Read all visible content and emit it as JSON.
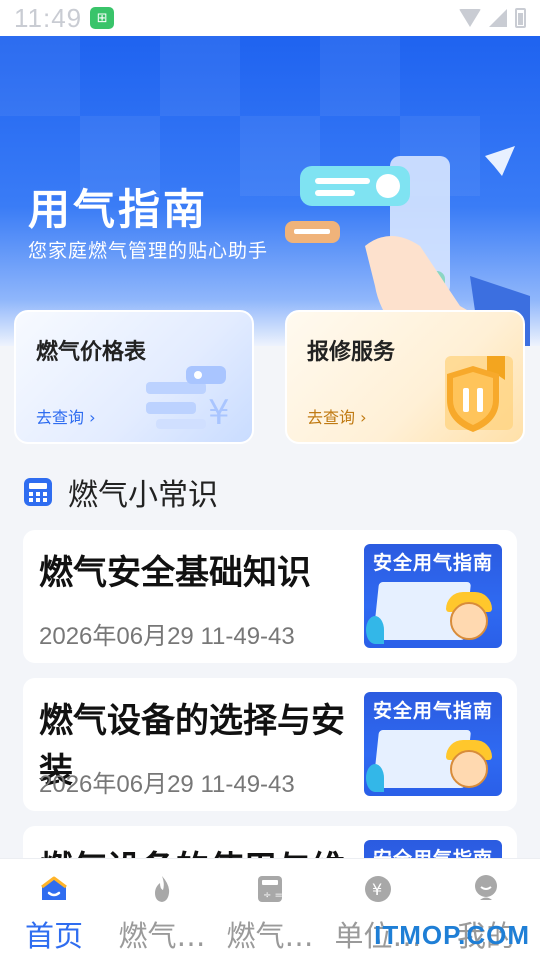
{
  "status_bar": {
    "time": "11:49",
    "notification_icon": "app-notification-icon"
  },
  "colors": {
    "primary": "#2f6df0",
    "hero_top": "#1f63f0",
    "repair_accent": "#c07a12",
    "tab_inactive": "#9a9a9a"
  },
  "hero": {
    "title": "用气指南",
    "subtitle": "您家庭燃气管理的贴心助手"
  },
  "services": [
    {
      "title": "燃气价格表",
      "link": "去查询 ›",
      "icon": "price-tag-icon"
    },
    {
      "title": "报修服务",
      "link": "去查询 ›",
      "icon": "repair-shield-icon"
    }
  ],
  "section": {
    "title": "燃气小常识",
    "icon": "calculator-icon"
  },
  "articles": [
    {
      "title": "燃气安全基础知识",
      "date": "2026年06月29 11-49-43",
      "thumb_title": "安全用气指南"
    },
    {
      "title": "燃气设备的选择与安装",
      "date": "2026年06月29 11-49-43",
      "thumb_title": "安全用气指南"
    },
    {
      "title": "燃气设备的使用与维",
      "date": "",
      "thumb_title": "安全用气指南"
    }
  ],
  "tabs": [
    {
      "label": "首页",
      "icon": "home-icon",
      "active": true
    },
    {
      "label": "燃气…",
      "icon": "flame-icon",
      "active": false
    },
    {
      "label": "燃气…",
      "icon": "calculator-icon",
      "active": false
    },
    {
      "label": "单位…",
      "icon": "currency-icon",
      "active": false
    },
    {
      "label": "我的",
      "icon": "profile-icon",
      "active": false
    }
  ],
  "watermark": "ITMOP.COM"
}
